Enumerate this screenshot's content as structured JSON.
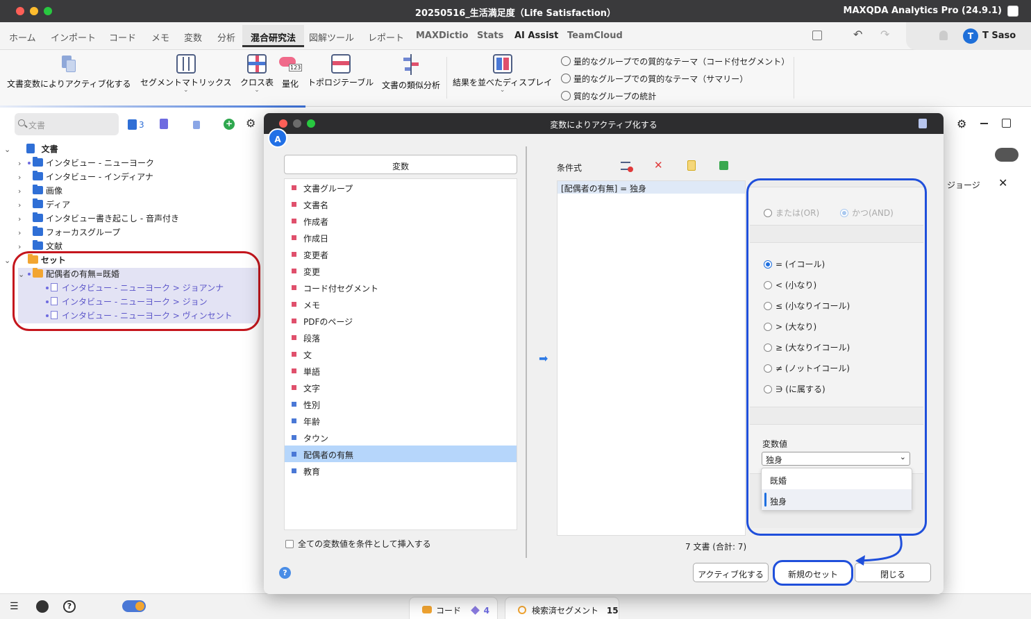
{
  "window": {
    "title": "20250516_生活満足度（Life Satisfaction）",
    "app_name": "MAXQDA Analytics Pro (24.9.1)"
  },
  "tabs": [
    "ホーム",
    "インポート",
    "コード",
    "メモ",
    "変数",
    "分析",
    "混合研究法",
    "図解ツール",
    "レポート",
    "MAXDictio",
    "Stats",
    "AI Assist",
    "TeamCloud"
  ],
  "active_tab": "混合研究法",
  "user": {
    "initial": "T",
    "name": "T Saso"
  },
  "toolbar": {
    "activate_by_doc_vars": "文書変数によりアクティブ化する",
    "segment_matrix": "セグメントマトリックス",
    "crosstab": "クロス表",
    "quantize": "量化",
    "topology_table": "トポロジテーブル",
    "doc_similarity": "文書の類似分析",
    "side_by_side": "結果を並べたディスプレイ",
    "quant_item1": "量的なグループでの質的なテーマ（コード付セグメント）",
    "quant_item2": "量的なグループでの質的なテーマ（サマリー）",
    "quant_item3": "質的なグループの統計",
    "quantize_icon_text": "123"
  },
  "left_panel": {
    "search_placeholder": "文書",
    "doc_count": "3",
    "tree": {
      "root": "文書",
      "groups": [
        "インタビュー - ニューヨーク",
        "インタビュー - インディアナ",
        "画像",
        "ディア",
        "インタビュー書き起こし - 音声付き",
        "フォーカスグループ",
        "文献"
      ],
      "sets_label": "セット",
      "set_name": "配偶者の有無=既婚",
      "set_docs": [
        "インタビュー - ニューヨーク > ジョアンナ",
        "インタビュー - ニューヨーク > ジョン",
        "インタビュー - ニューヨーク > ヴィンセント"
      ]
    }
  },
  "right_panel": {
    "item": "ジョージ"
  },
  "dialog": {
    "title": "変数によりアクティブ化する",
    "badge": "A",
    "variables_header": "変数",
    "variables": [
      {
        "name": "文書グループ",
        "color": "#e0506c"
      },
      {
        "name": "文書名",
        "color": "#e0506c"
      },
      {
        "name": "作成者",
        "color": "#e0506c"
      },
      {
        "name": "作成日",
        "color": "#e0506c"
      },
      {
        "name": "変更者",
        "color": "#e0506c"
      },
      {
        "name": "変更",
        "color": "#e0506c"
      },
      {
        "name": "コード付セグメント",
        "color": "#e0506c"
      },
      {
        "name": "メモ",
        "color": "#e0506c"
      },
      {
        "name": "PDFのページ",
        "color": "#e0506c"
      },
      {
        "name": "段落",
        "color": "#e0506c"
      },
      {
        "name": "文",
        "color": "#e0506c"
      },
      {
        "name": "単語",
        "color": "#e0506c"
      },
      {
        "name": "文字",
        "color": "#e0506c"
      },
      {
        "name": "性別",
        "color": "#4a78d6"
      },
      {
        "name": "年齢",
        "color": "#4a78d6"
      },
      {
        "name": "タウン",
        "color": "#4a78d6"
      },
      {
        "name": "配偶者の有無",
        "color": "#4a78d6"
      },
      {
        "name": "教育",
        "color": "#4a78d6"
      }
    ],
    "selected_variable": "配偶者の有無",
    "insert_all_label": "全ての変数値を条件として挿入する",
    "conditions_label": "条件式",
    "condition": "[配偶者の有無] = 独身",
    "logic": {
      "or": "または(OR)",
      "and": "かつ(AND)",
      "selected": "and"
    },
    "operators": [
      "= (イコール)",
      "< (小なり)",
      "≤ (小なりイコール)",
      "> (大なり)",
      "≥ (大なりイコール)",
      "≠ (ノットイコール)",
      "∋ (に属する)"
    ],
    "selected_operator": "= (イコール)",
    "value_label": "変数値",
    "value_selected": "独身",
    "value_options": [
      "既婚",
      "独身"
    ],
    "doc_count": "7 文書 (合計: 7)",
    "buttons": {
      "activate": "アクティブ化する",
      "new_set": "新規のセット",
      "close": "閉じる"
    }
  },
  "statusbar": {
    "codes_label": "コード",
    "codes_count": "4",
    "segments_label": "検索済セグメント",
    "segments_count": "15"
  },
  "colors": {
    "highlight_red": "#c5161d",
    "highlight_blue": "#1f4fdb",
    "selection": "#b6d6fb"
  }
}
